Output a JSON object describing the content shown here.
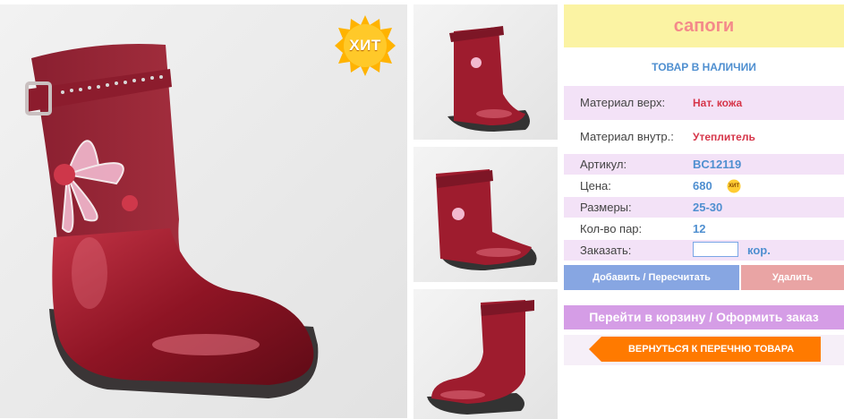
{
  "product": {
    "title": "сапоги",
    "stock_status": "ТОВАР В НАЛИЧИИ",
    "badge": "ХИТ",
    "specs": {
      "material_top_label": "Материал верх:",
      "material_top_value": "Нат. кожа",
      "material_inner_label": "Материал внутр.:",
      "material_inner_value": "Утеплитель",
      "article_label": "Артикул:",
      "article_value": "BC12119",
      "price_label": "Цена:",
      "price_value": "680",
      "price_badge": "ХИТ",
      "sizes_label": "Размеры:",
      "sizes_value": "25-30",
      "pairs_label": "Кол-во пар:",
      "pairs_value": "12",
      "order_label": "Заказать:",
      "order_value": "",
      "order_unit": "кор."
    }
  },
  "actions": {
    "update": "Добавить / Пересчитать",
    "delete": "Удалить",
    "cart": "Перейти в корзину / Оформить заказ",
    "back": "ВЕРНУТЬСЯ К ПЕРЕЧНЮ ТОВАРА"
  },
  "colors": {
    "title_bg": "#fbf3a3",
    "title_text": "#f48a8a",
    "accent_blue": "#4f8fd0",
    "row_pink": "#f3e2f7",
    "cart_button": "#d59de6",
    "back_button": "#ff7a00",
    "boot_red": "#9e1c2e"
  }
}
